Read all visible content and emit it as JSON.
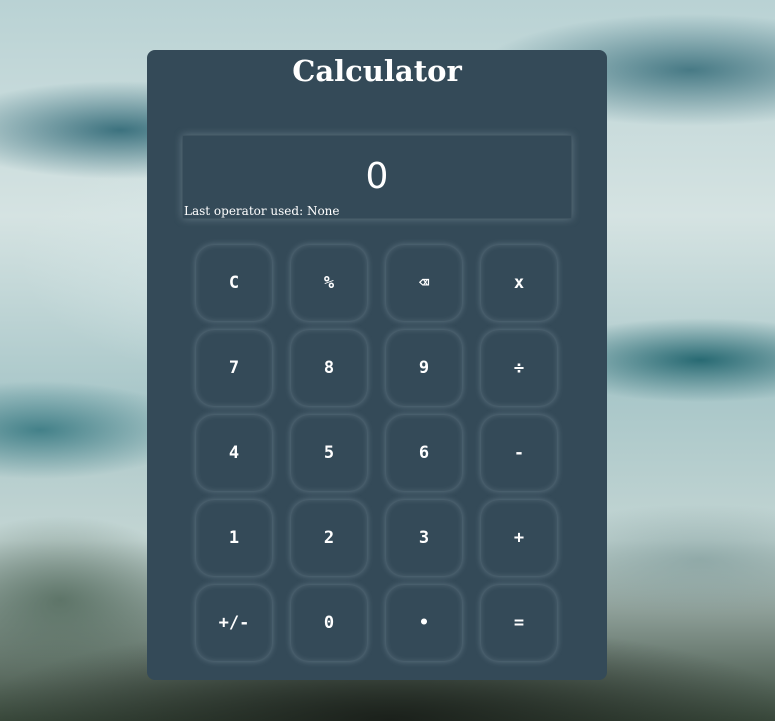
{
  "calculator": {
    "title": "Calculator",
    "display": {
      "value": "0",
      "last_operator_label": "Last operator used: None"
    },
    "keys": [
      {
        "label": "C",
        "name": "clear-button"
      },
      {
        "label": "%",
        "name": "percent-button"
      },
      {
        "label": "⌫",
        "name": "backspace-button"
      },
      {
        "label": "x",
        "name": "multiply-button"
      },
      {
        "label": "7",
        "name": "digit-7-button"
      },
      {
        "label": "8",
        "name": "digit-8-button"
      },
      {
        "label": "9",
        "name": "digit-9-button"
      },
      {
        "label": "÷",
        "name": "divide-button"
      },
      {
        "label": "4",
        "name": "digit-4-button"
      },
      {
        "label": "5",
        "name": "digit-5-button"
      },
      {
        "label": "6",
        "name": "digit-6-button"
      },
      {
        "label": "-",
        "name": "subtract-button"
      },
      {
        "label": "1",
        "name": "digit-1-button"
      },
      {
        "label": "2",
        "name": "digit-2-button"
      },
      {
        "label": "3",
        "name": "digit-3-button"
      },
      {
        "label": "+",
        "name": "add-button"
      },
      {
        "label": "+/-",
        "name": "negate-button"
      },
      {
        "label": "0",
        "name": "digit-0-button"
      },
      {
        "label": "•",
        "name": "decimal-button"
      },
      {
        "label": "=",
        "name": "equals-button"
      }
    ]
  },
  "colors": {
    "panel": "#344a58",
    "text": "#ffffff"
  }
}
